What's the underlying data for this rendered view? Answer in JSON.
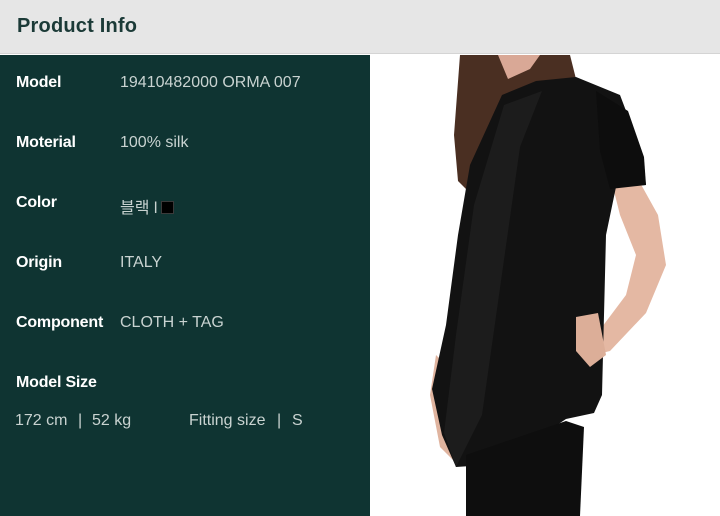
{
  "header": {
    "title": "Product Info"
  },
  "specs": [
    {
      "label": "Model",
      "value": "19410482000 ORMA 007"
    },
    {
      "label": "Moterial",
      "value": "100% silk"
    },
    {
      "label": "Color",
      "value": "블랙 l"
    },
    {
      "label": "Origin",
      "value": "ITALY"
    },
    {
      "label": "Component",
      "value": "CLOTH + TAG"
    }
  ],
  "model_size": {
    "label": "Model Size",
    "height": "172 cm",
    "sep1": "|",
    "weight": "52 kg",
    "fitting_label": "Fitting size",
    "sep2": "|",
    "fitting_value": "S"
  },
  "colors": {
    "panel": "#0f3432",
    "header_bg": "#e6e6e6",
    "header_text": "#1b3a37",
    "color_swatch": "#000000"
  }
}
